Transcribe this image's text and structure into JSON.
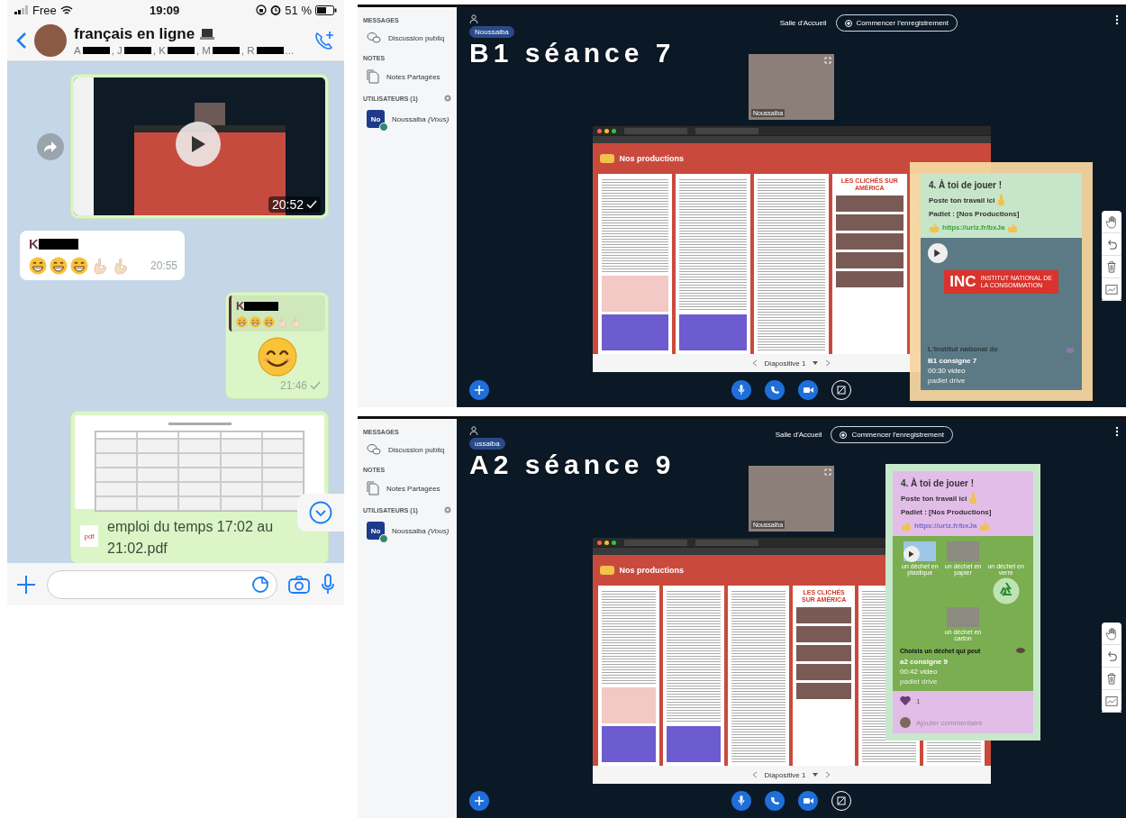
{
  "chat": {
    "status_bar": {
      "carrier": "Free",
      "time": "19:09",
      "battery": "51 %"
    },
    "header": {
      "title": "français en ligne",
      "members": [
        "A",
        ", J",
        ", K",
        ", M",
        ", R"
      ],
      "members_end": "..."
    },
    "messages": [
      {
        "kind": "video",
        "outgoing": true,
        "time": "20:52"
      },
      {
        "kind": "emoji",
        "outgoing": false,
        "sender": "K",
        "emojis": [
          {
            "kind": "grin"
          },
          {
            "kind": "grin"
          },
          {
            "kind": "grin"
          },
          {
            "kind": "ok"
          },
          {
            "kind": "ok"
          }
        ],
        "time": "20:55"
      },
      {
        "kind": "reply",
        "outgoing": true,
        "quote_sender": "K",
        "quote_emojis": [
          {
            "kind": "grin"
          },
          {
            "kind": "grin"
          },
          {
            "kind": "grin"
          },
          {
            "kind": "ok"
          },
          {
            "kind": "ok"
          }
        ],
        "emojis": [
          {
            "kind": "smile"
          }
        ],
        "time": "21:46"
      },
      {
        "kind": "document",
        "outgoing": true,
        "filename": "emploi du temps 17:02 au 21:02.pdf",
        "file_type": "pdf"
      }
    ]
  },
  "sessions": [
    {
      "overlay_title": "B1 séance 7",
      "sidebar": [
        {
          "heading": "MESSAGES",
          "items": [
            {
              "kind": "chat",
              "label": "Discussion publiq"
            }
          ]
        },
        {
          "heading": "NOTES",
          "items": [
            {
              "kind": "notes",
              "label": "Notes Partagées"
            }
          ]
        },
        {
          "heading": "UTILISATEURS (1)",
          "items": [
            {
              "kind": "user",
              "initials": "No",
              "label": "Noussaiba *(Vous)*"
            }
          ]
        }
      ],
      "presenter": "Noussaiba",
      "room": "Salle d'Accueil",
      "record_button": "Commencer l'enregistrement",
      "webcam": {
        "name": "Noussaiba"
      },
      "presentation": {
        "board_title": "Nos productions",
        "poster_text": "LES CLICHÉS SUR AMÉRICA",
        "slide": "Diapositive 1"
      },
      "card": {
        "kind": "video",
        "title": "4. À toi de jouer !",
        "instruction": "Poste ton travail ici",
        "board_line": "Padlet : [Nos Productions]",
        "link": "https://urlz.fr/bxJa",
        "media": {
          "logo": "INC",
          "logo_caption": "INSTITUT NATIONAL DE LA CONSOMMATION",
          "caption": "L'Institut national de"
        },
        "attachment": {
          "title": "B1 consigne 7",
          "meta": "00:30 video",
          "source": "padlet drive"
        }
      }
    },
    {
      "overlay_title": "A2 séance 9",
      "sidebar": [
        {
          "heading": "MESSAGES",
          "items": [
            {
              "kind": "chat",
              "label": "Discussion publiq"
            }
          ]
        },
        {
          "heading": "NOTES",
          "items": [
            {
              "kind": "notes",
              "label": "Notes Partagées"
            }
          ]
        },
        {
          "heading": "UTILISATEURS (1)",
          "items": [
            {
              "kind": "user",
              "initials": "No",
              "label": "Noussaiba *(Vous)*"
            }
          ]
        }
      ],
      "presenter": "ussaiba",
      "room": "Salle d'Accueil",
      "record_button": "Commencer l'enregistrement",
      "webcam": {
        "name": "Noussaiba"
      },
      "presentation": {
        "board_title": "Nos productions",
        "poster_text": "LES CLICHÉS SUR AMÉRICA",
        "slide": "Diapositive 1"
      },
      "card": {
        "kind": "gallery",
        "title": "4. À toi de jouer !",
        "instruction": "Poste ton travail ici",
        "board_line": "Padlet : [Nos Productions]",
        "link": "https://urlz.fr/bxJa",
        "media": {
          "items": [
            {
              "kind": "video",
              "caption": "un déchet en plastique"
            },
            {
              "kind": "photo",
              "caption": "un déchet en papier"
            },
            {
              "kind": "recycle",
              "caption": "un déchet en verre"
            },
            {
              "kind": "photo",
              "caption": "un déchet en carton"
            }
          ],
          "caption": "Choisis un déchet qui peut"
        },
        "attachment": {
          "title": "a2 consigne 9",
          "meta": "00:42 video",
          "source": "padlet drive"
        },
        "likes": "1",
        "comment": {
          "placeholder": "Ajouter commentaire"
        }
      }
    }
  ]
}
